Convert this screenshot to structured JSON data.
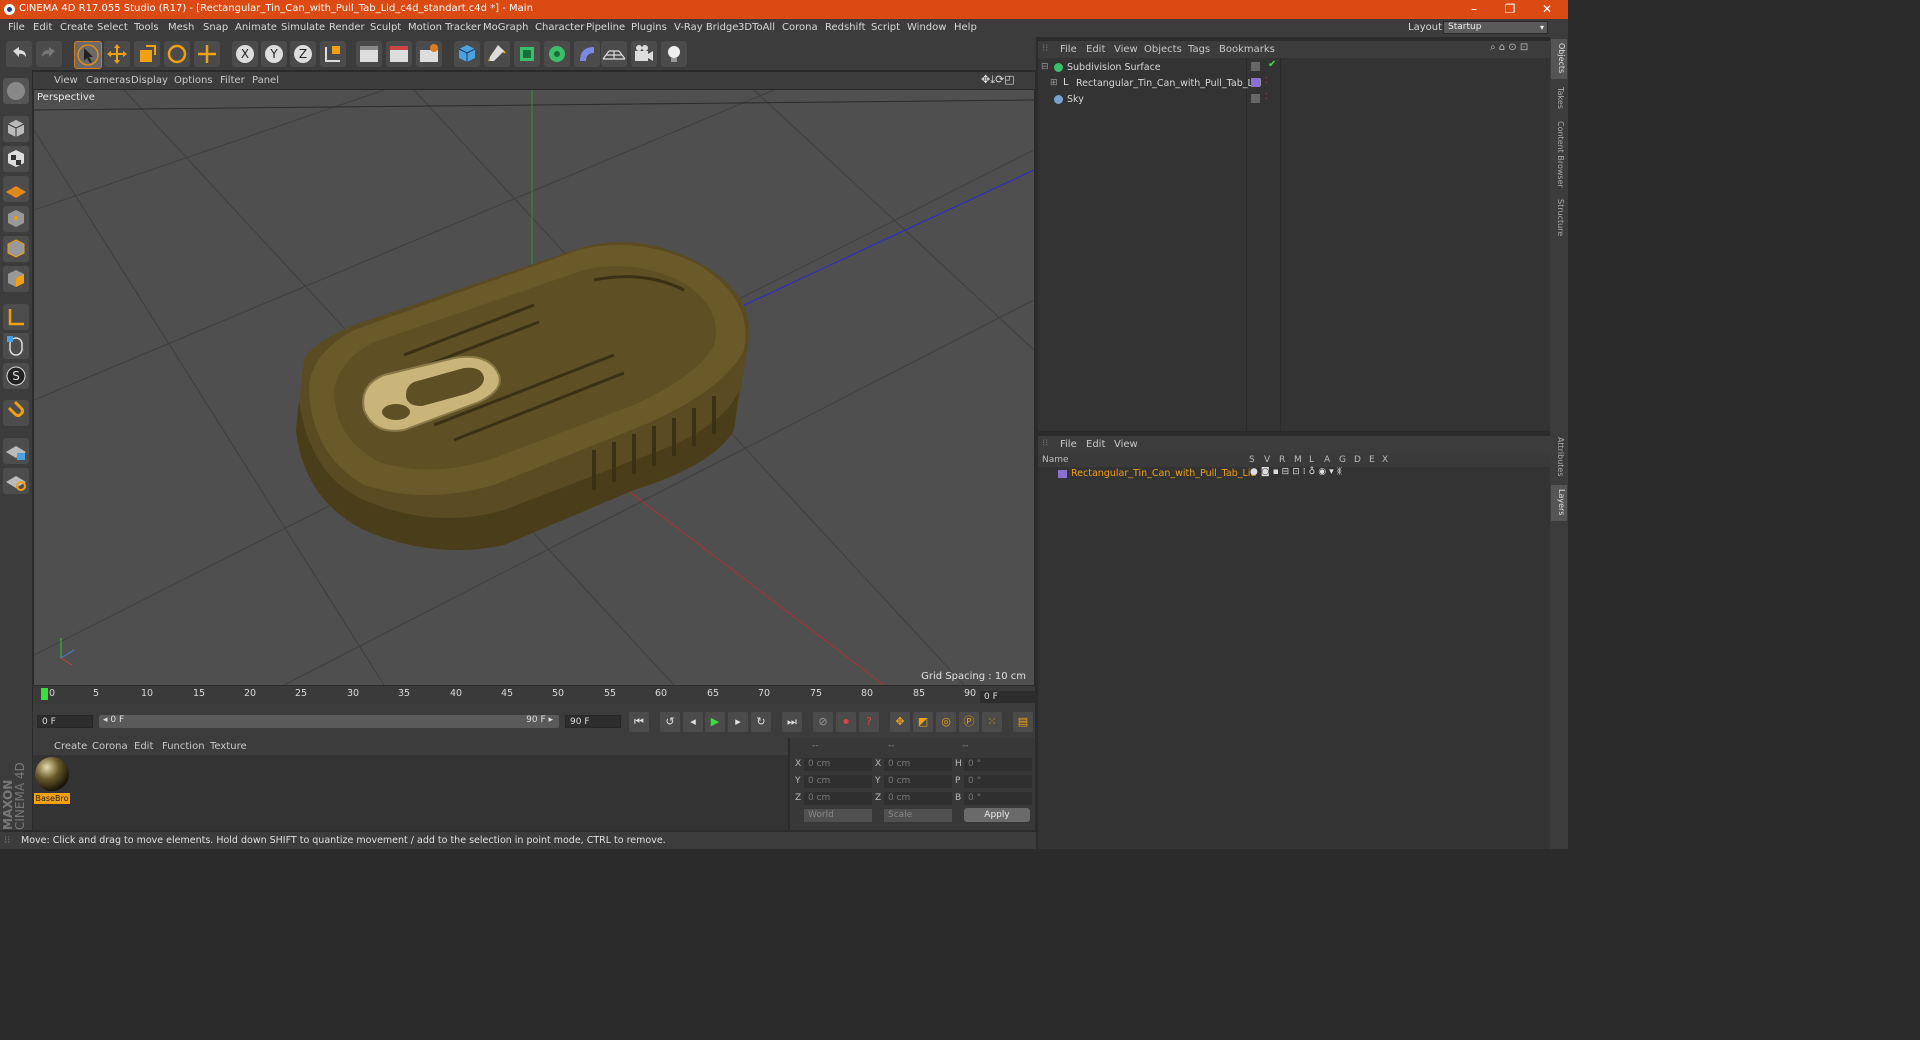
{
  "window": {
    "title": "CINEMA 4D R17.055 Studio (R17) - [Rectangular_Tin_Can_with_Pull_Tab_Lid_c4d_standart.c4d *] - Main",
    "minimize": "–",
    "restore": "❐",
    "close": "✕"
  },
  "menubar": {
    "items": [
      "File",
      "Edit",
      "Create",
      "Select",
      "Tools",
      "Mesh",
      "Snap",
      "Animate",
      "Simulate",
      "Render",
      "Sculpt",
      "Motion Tracker",
      "MoGraph",
      "Character",
      "Pipeline",
      "Plugins",
      "V-Ray Bridge",
      "3DToAll",
      "Corona",
      "Redshift",
      "Script",
      "Window",
      "Help"
    ],
    "layout_label": "Layout:",
    "layout_value": "Startup"
  },
  "viewport": {
    "menu": [
      "View",
      "Cameras",
      "Display",
      "Options",
      "Filter",
      "Panel"
    ],
    "label": "Perspective",
    "grid_spacing": "Grid Spacing : 10 cm"
  },
  "timeline": {
    "ticks": [
      "0",
      "5",
      "10",
      "15",
      "20",
      "25",
      "30",
      "35",
      "40",
      "45",
      "50",
      "55",
      "60",
      "65",
      "70",
      "75",
      "80",
      "85",
      "90"
    ],
    "current_frame": "0 F",
    "start_field": "0 F",
    "range_start": "◂ 0 F",
    "range_end": "90 F ▸",
    "end_field": "90 F"
  },
  "materials": {
    "menu": [
      "Create",
      "Corona",
      "Edit",
      "Function",
      "Texture"
    ],
    "items": [
      {
        "name": "BaseBro"
      }
    ]
  },
  "coordinates": {
    "header": [
      "--",
      "--",
      "--"
    ],
    "rows": [
      {
        "l1": "X",
        "v1": "0 cm",
        "l2": "X",
        "v2": "0 cm",
        "l3": "H",
        "v3": "0 °"
      },
      {
        "l1": "Y",
        "v1": "0 cm",
        "l2": "Y",
        "v2": "0 cm",
        "l3": "P",
        "v3": "0 °"
      },
      {
        "l1": "Z",
        "v1": "0 cm",
        "l2": "Z",
        "v2": "0 cm",
        "l3": "B",
        "v3": "0 °"
      }
    ],
    "mode1": "World",
    "mode2": "Scale",
    "apply": "Apply"
  },
  "status": {
    "text": "Move: Click and drag to move elements. Hold down SHIFT to quantize movement / add to the selection in point mode, CTRL to remove."
  },
  "objects": {
    "menu": [
      "File",
      "Edit",
      "View",
      "Objects",
      "Tags",
      "Bookmarks"
    ],
    "items": [
      {
        "name": "Subdivision Surface"
      },
      {
        "name": "Rectangular_Tin_Can_with_Pull_Tab_Lid"
      },
      {
        "name": "Sky"
      }
    ]
  },
  "layers": {
    "menu": [
      "File",
      "Edit",
      "View"
    ],
    "columns": [
      "Name",
      "S",
      "V",
      "R",
      "M",
      "L",
      "A",
      "G",
      "D",
      "E",
      "X"
    ],
    "items": [
      {
        "name": "Rectangular_Tin_Can_with_Pull_Tab_Lid",
        "color": "#8a6fd6"
      }
    ]
  },
  "side_tabs": [
    "Objects",
    "Takes",
    "Content Browser",
    "Structure",
    "Attributes",
    "Layers"
  ],
  "brand": {
    "maxon": "MAXON",
    "product": "CINEMA 4D"
  },
  "colors": {
    "title_bar": "#dc4a13",
    "accent": "#f0a010",
    "can": "#6a5a2a"
  }
}
